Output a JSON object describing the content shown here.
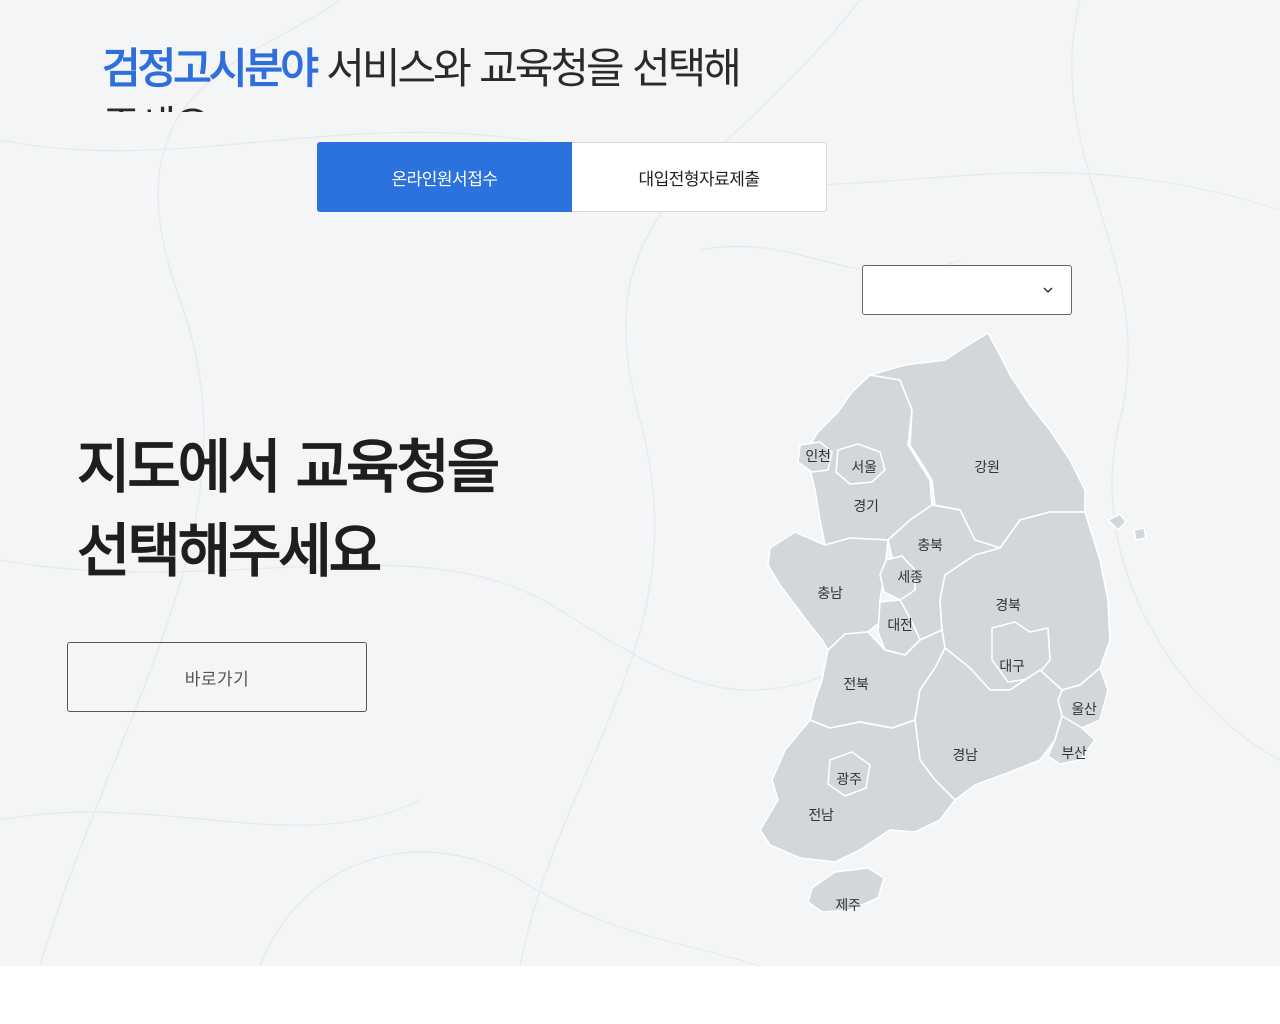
{
  "headline": {
    "accent": "검정고시분야",
    "rest": " 서비스와 교육청을 선택해 주세요"
  },
  "tabs": [
    {
      "label": "온라인원서접수",
      "active": true
    },
    {
      "label": "대입전형자료제출",
      "active": false
    }
  ],
  "region_select": {
    "value": "",
    "icon": "chevron-down-icon"
  },
  "map_title": {
    "line1": "지도에서 교육청을",
    "line2": "선택해주세요"
  },
  "goto_button": "바로가기",
  "regions": {
    "incheon": "인천",
    "seoul": "서울",
    "gyeonggi": "경기",
    "gangwon": "강원",
    "chungbuk": "충북",
    "sejong": "세종",
    "chungnam": "충남",
    "daejeon": "대전",
    "gyeongbuk": "경북",
    "daegu": "대구",
    "jeonbuk": "전북",
    "ulsan": "울산",
    "gyeongnam": "경남",
    "busan": "부산",
    "gwangju": "광주",
    "jeonnam": "전남",
    "jeju": "제주"
  },
  "colors": {
    "accent": "#2f6fdd",
    "tab_active": "#2c72df",
    "map_fill": "#d3d7da",
    "hero_bg": "#f3f5f6"
  }
}
